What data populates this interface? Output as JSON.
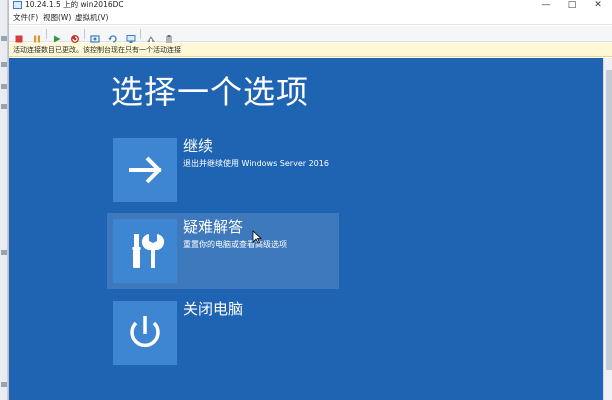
{
  "window": {
    "title": "10.24.1.5 上的 win2016DC",
    "controls": {
      "minimize": "—",
      "maximize": "□",
      "close": "✕"
    }
  },
  "menu": {
    "items": [
      {
        "label": "文件(F)"
      },
      {
        "label": "视图(W)"
      },
      {
        "label": "虚拟机(V)"
      }
    ]
  },
  "toolbar": {
    "buttons": [
      {
        "icon": "ctrl-alt-del-icon",
        "color": "#6a6a6a"
      },
      {
        "icon": "stop-icon",
        "color": "#d83b3b"
      },
      {
        "icon": "pause-icon",
        "color": "#e0962a"
      },
      {
        "icon": "start-icon",
        "color": "#2e9a3e"
      },
      {
        "icon": "reset-icon",
        "color": "#c0392b"
      },
      {
        "icon": "checkpoint-icon",
        "color": "#3b7fc4"
      },
      {
        "icon": "revert-icon",
        "color": "#3b7fc4"
      },
      {
        "icon": "enhanced-session-icon",
        "color": "#3b7fc4"
      },
      {
        "icon": "share-icon",
        "color": "#6a6a6a"
      },
      {
        "icon": "clipboard-icon",
        "color": "#6a6a6a"
      }
    ]
  },
  "notice": {
    "text": "活动连接数目已更改。该控制台现在只有一个活动连接"
  },
  "screen": {
    "title": "选择一个选项",
    "background_color": "#1f63b3",
    "options": [
      {
        "title": "继续",
        "description": "退出并继续使用 Windows Server 2016",
        "icon": "arrow-right-icon",
        "selected": false
      },
      {
        "title": "疑难解答",
        "description": "重置你的电脑或查看高级选项",
        "icon": "tools-icon",
        "selected": true
      },
      {
        "title": "关闭电脑",
        "description": "",
        "icon": "power-icon",
        "selected": false
      }
    ]
  }
}
